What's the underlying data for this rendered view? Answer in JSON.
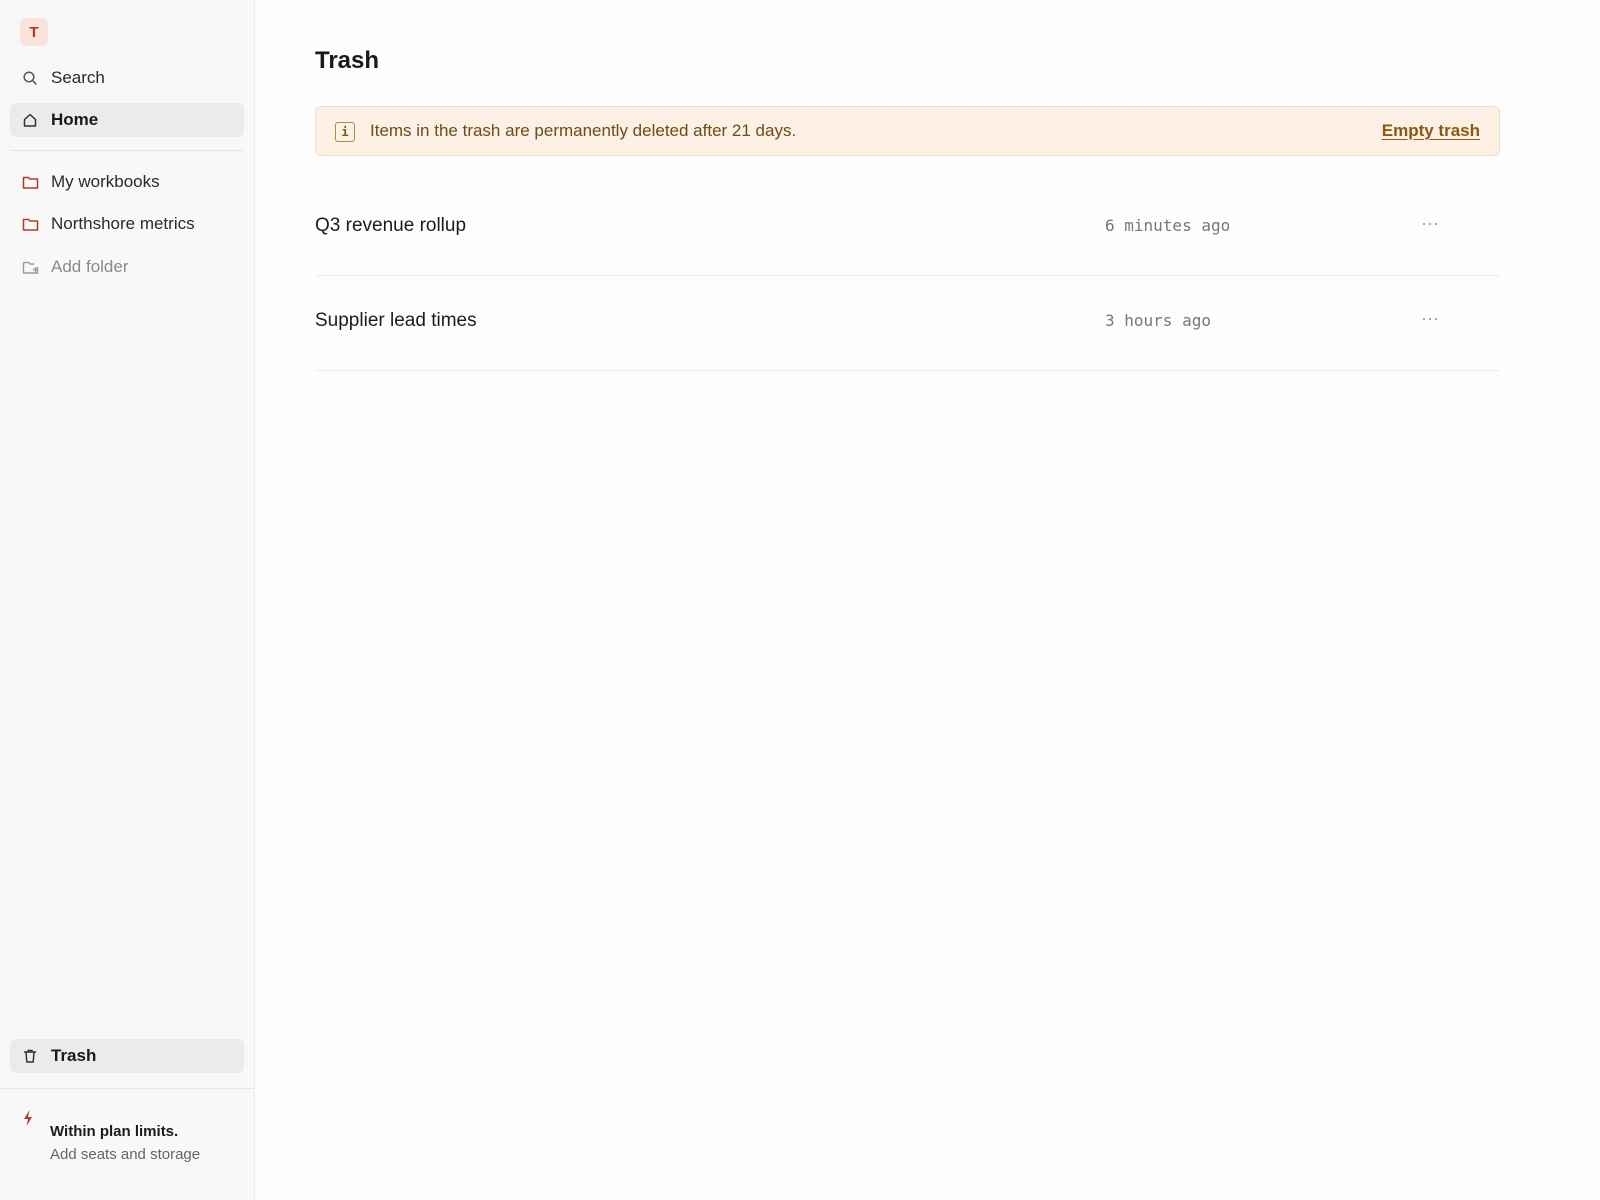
{
  "workspace": {
    "initial": "T"
  },
  "sidebar": {
    "search_label": "Search",
    "home_label": "Home",
    "folders": [
      {
        "label": "My workbooks"
      },
      {
        "label": "Northshore metrics"
      }
    ],
    "add_folder_label": "Add folder",
    "trash_label": "Trash"
  },
  "plan": {
    "status": "Within plan limits.",
    "cta": "Add seats and storage"
  },
  "main": {
    "title": "Trash",
    "banner": {
      "icon": "i",
      "message": "Items in the trash are permanently deleted after 21 days.",
      "action": "Empty trash"
    },
    "items": [
      {
        "name": "Q3 revenue rollup",
        "deleted": "6 minutes ago",
        "more": "···"
      },
      {
        "name": "Supplier lead times",
        "deleted": "3 hours ago",
        "more": "···"
      }
    ]
  },
  "colors": {
    "accent": "#b23b27",
    "banner_bg": "#fcf1e4",
    "banner_text": "#6b4d16"
  }
}
